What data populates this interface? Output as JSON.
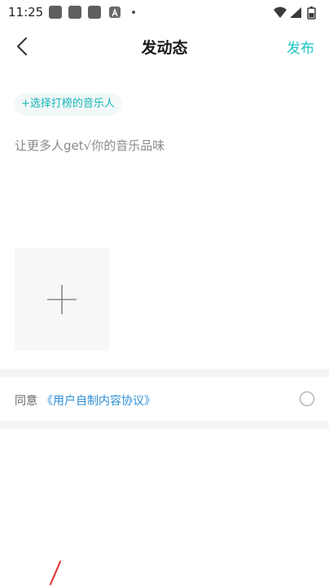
{
  "status_bar": {
    "time": "11:25",
    "icons": [
      "notification-icon",
      "notification-icon",
      "notification-icon",
      "a-icon",
      "dot-icon",
      "wifi-icon",
      "signal-icon",
      "battery-icon"
    ]
  },
  "header": {
    "title": "发动态",
    "publish_label": "发布",
    "back_icon": "chevron-left-icon"
  },
  "musician_chip": {
    "label": "+选择打榜的音乐人"
  },
  "post_input": {
    "placeholder": "让更多人get√你的音乐品味",
    "value": ""
  },
  "media": {
    "add_icon": "plus-icon"
  },
  "agreement": {
    "prefix": "同意",
    "link": "《用户自制内容协议》",
    "checked": false
  },
  "colors": {
    "accent": "#1cc5c5",
    "link": "#2e8fd8",
    "chip_bg": "#f2f7f8",
    "divider": "#f5f5f5"
  }
}
